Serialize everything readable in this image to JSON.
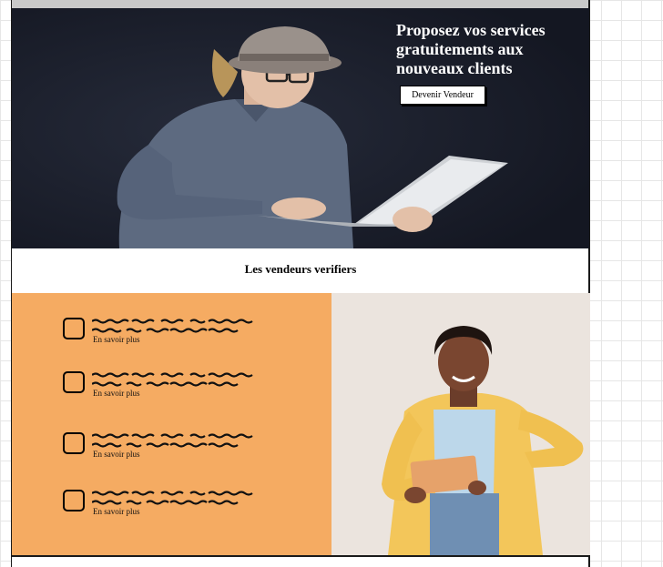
{
  "hero": {
    "title": "Proposez vos services gratuitements aux nouveaux clients",
    "cta_label": "Devenir Vendeur"
  },
  "section": {
    "verified_heading": "Les vendeurs verifiers"
  },
  "features": [
    {
      "link_label": "En savoir plus"
    },
    {
      "link_label": "En savoir plus"
    },
    {
      "link_label": "En savoir plus"
    },
    {
      "link_label": "En savoir plus"
    }
  ],
  "colors": {
    "hero_bg": "#1b1f2b",
    "feature_panel": "#f5ab62",
    "photo_bg": "#ebe4de",
    "jacket": "#f3c65a"
  },
  "icons": {
    "feature_icon": "checkbox-icon"
  }
}
